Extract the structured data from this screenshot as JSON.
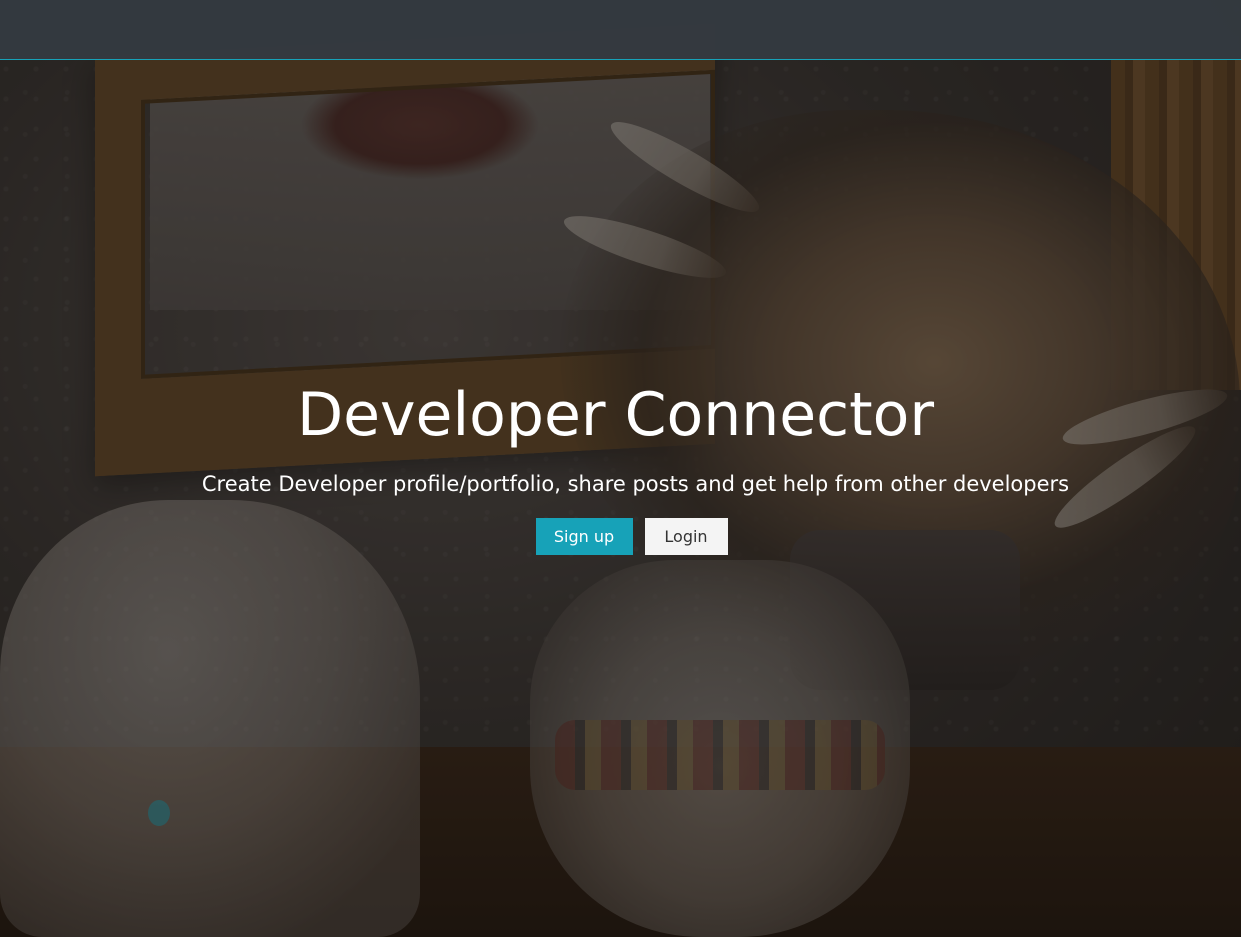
{
  "landing": {
    "title": "Developer Connector",
    "lead": "Create Developer profile/portfolio, share posts and get help from other developers",
    "signup_label": "Sign up",
    "login_label": "Login"
  },
  "theme": {
    "primary": "#17a2b8",
    "navbar": "#343a40",
    "light": "#f4f4f4"
  }
}
